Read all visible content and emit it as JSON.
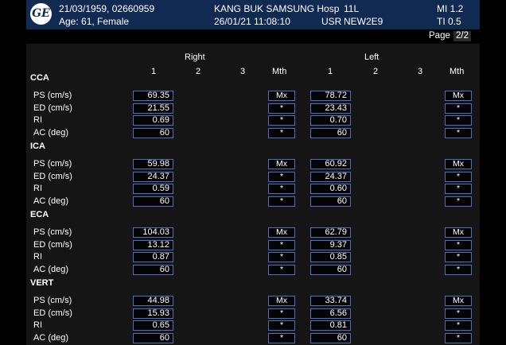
{
  "header": {
    "dob_id": "21/03/1959, 02660959",
    "age_sex": "Age: 61, Female",
    "hospital": "KANG BUK SAMSUNG Hosp",
    "datetime": "26/01/21 11:08:10",
    "probe": "11L",
    "user": "USR",
    "preset": "NEW2E9",
    "mi": "MI 1.2",
    "ti": "TI 0.5",
    "logo": "ge-logo"
  },
  "page": {
    "label": "Page",
    "value": "2/2"
  },
  "columns": {
    "right_title": "Right",
    "left_title": "Left",
    "nums": [
      "1",
      "2",
      "3"
    ],
    "mth": "Mth"
  },
  "sections": [
    {
      "name": "CCA",
      "rows": [
        {
          "label": "PS (cm/s)",
          "right": "69.35",
          "right_mth": "Mx",
          "left": "78.72",
          "left_mth": "Mx"
        },
        {
          "label": "ED (cm/s)",
          "right": "21.55",
          "right_mth": "*",
          "left": "23.43",
          "left_mth": "*"
        },
        {
          "label": "RI",
          "right": "0.69",
          "right_mth": "*",
          "left": "0.70",
          "left_mth": "*"
        },
        {
          "label": "AC (deg)",
          "right": "60",
          "right_mth": "*",
          "left": "60",
          "left_mth": "*"
        }
      ]
    },
    {
      "name": "ICA",
      "rows": [
        {
          "label": "PS (cm/s)",
          "right": "59.98",
          "right_mth": "Mx",
          "left": "60.92",
          "left_mth": "Mx"
        },
        {
          "label": "ED (cm/s)",
          "right": "24.37",
          "right_mth": "*",
          "left": "24.37",
          "left_mth": "*"
        },
        {
          "label": "RI",
          "right": "0.59",
          "right_mth": "*",
          "left": "0.60",
          "left_mth": "*"
        },
        {
          "label": "AC (deg)",
          "right": "60",
          "right_mth": "*",
          "left": "60",
          "left_mth": "*"
        }
      ]
    },
    {
      "name": "ECA",
      "rows": [
        {
          "label": "PS (cm/s)",
          "right": "104.03",
          "right_mth": "Mx",
          "left": "62.79",
          "left_mth": "Mx"
        },
        {
          "label": "ED (cm/s)",
          "right": "13.12",
          "right_mth": "*",
          "left": "9.37",
          "left_mth": "*"
        },
        {
          "label": "RI",
          "right": "0.87",
          "right_mth": "*",
          "left": "0.85",
          "left_mth": "*"
        },
        {
          "label": "AC (deg)",
          "right": "60",
          "right_mth": "*",
          "left": "60",
          "left_mth": "*"
        }
      ]
    },
    {
      "name": "VERT",
      "rows": [
        {
          "label": "PS (cm/s)",
          "right": "44.98",
          "right_mth": "Mx",
          "left": "33.74",
          "left_mth": "Mx"
        },
        {
          "label": "ED (cm/s)",
          "right": "15.93",
          "right_mth": "*",
          "left": "6.56",
          "left_mth": "*"
        },
        {
          "label": "RI",
          "right": "0.65",
          "right_mth": "*",
          "left": "0.81",
          "left_mth": "*"
        },
        {
          "label": "AC (deg)",
          "right": "60",
          "right_mth": "*",
          "left": "60",
          "left_mth": "*"
        }
      ]
    }
  ]
}
